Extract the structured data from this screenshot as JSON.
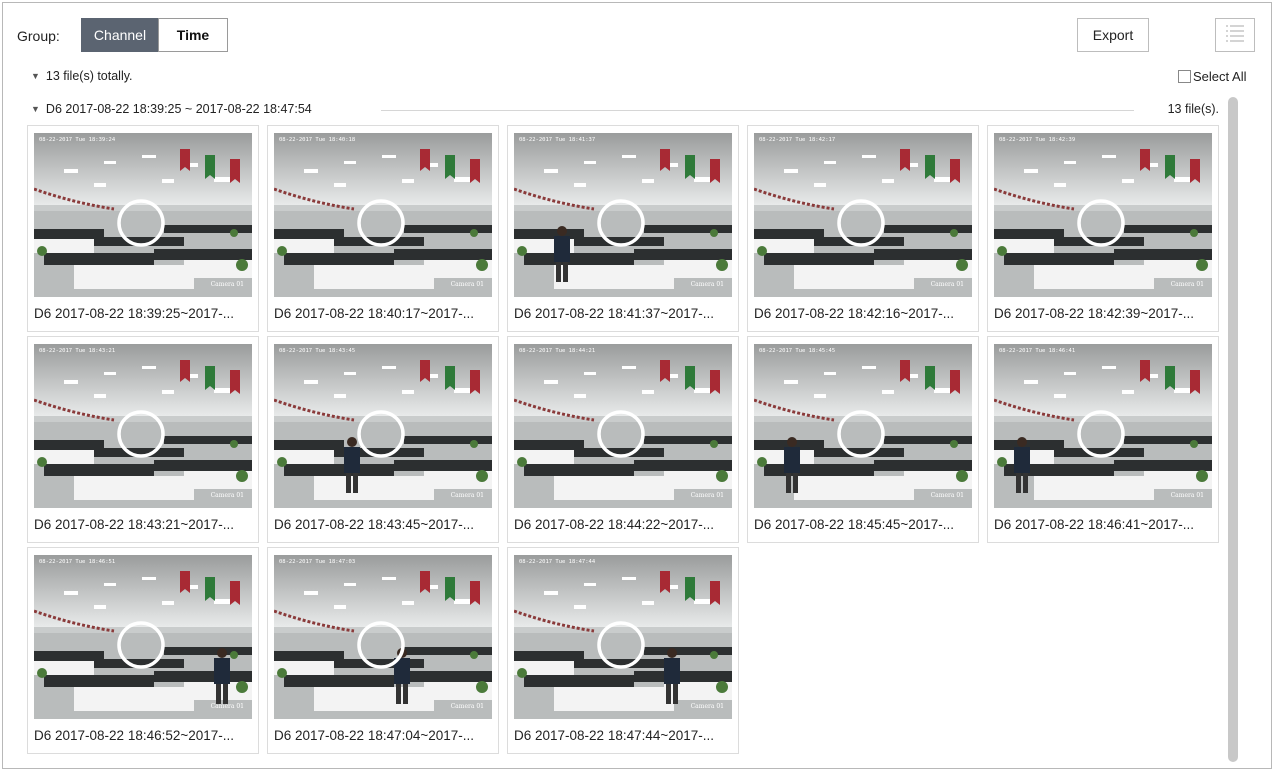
{
  "toolbar": {
    "group_label": "Group:",
    "channel_label": "Channel",
    "time_label": "Time",
    "export_label": "Export",
    "grid_view_icon": "grid-view-icon",
    "list_view_icon": "list-view-icon",
    "accent_color": "#5b6471"
  },
  "summary": {
    "text": "13 file(s) totally.",
    "select_all": "Select All"
  },
  "group": {
    "title": "D6 2017-08-22 18:39:25 ~ 2017-08-22 18:47:54",
    "count": "13 file(s)."
  },
  "thumbnail": {
    "camera_label": "Camera 01"
  },
  "files": [
    {
      "caption": "D6 2017-08-22 18:39:25~2017-...",
      "overlay": "08-22-2017 Tue 18:39:24"
    },
    {
      "caption": "D6 2017-08-22 18:40:17~2017-...",
      "overlay": "08-22-2017 Tue 18:40:18"
    },
    {
      "caption": "D6 2017-08-22 18:41:37~2017-...",
      "overlay": "08-22-2017 Tue 18:41:37"
    },
    {
      "caption": "D6 2017-08-22 18:42:16~2017-...",
      "overlay": "08-22-2017 Tue 18:42:17"
    },
    {
      "caption": "D6 2017-08-22 18:42:39~2017-...",
      "overlay": "08-22-2017 Tue 18:42:39"
    },
    {
      "caption": "D6 2017-08-22 18:43:21~2017-...",
      "overlay": "08-22-2017 Tue 18:43:21"
    },
    {
      "caption": "D6 2017-08-22 18:43:45~2017-...",
      "overlay": "08-22-2017 Tue 18:43:45"
    },
    {
      "caption": "D6 2017-08-22 18:44:22~2017-...",
      "overlay": "08-22-2017 Tue 18:44:21"
    },
    {
      "caption": "D6 2017-08-22 18:45:45~2017-...",
      "overlay": "08-22-2017 Tue 18:45:45"
    },
    {
      "caption": "D6 2017-08-22 18:46:41~2017-...",
      "overlay": "08-22-2017 Tue 18:46:41"
    },
    {
      "caption": "D6 2017-08-22 18:46:52~2017-...",
      "overlay": "08-22-2017 Tue 18:46:51"
    },
    {
      "caption": "D6 2017-08-22 18:47:04~2017-...",
      "overlay": "08-22-2017 Tue 18:47:03"
    },
    {
      "caption": "D6 2017-08-22 18:47:44~2017-...",
      "overlay": "08-22-2017 Tue 18:47:44"
    }
  ]
}
